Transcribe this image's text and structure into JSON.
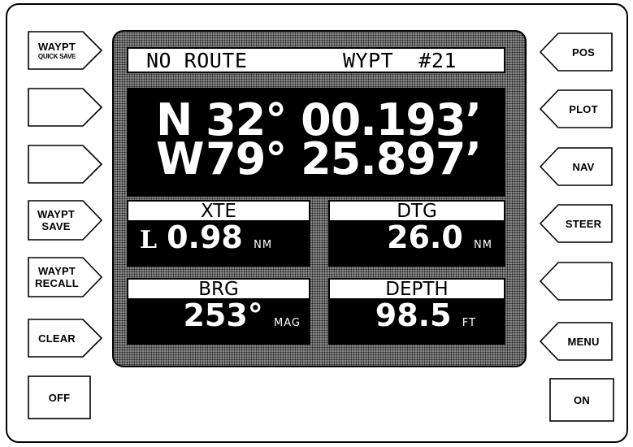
{
  "left_keys": {
    "waypt_quick_save": {
      "line1": "WAYPT",
      "line2": "QUICK SAVE"
    },
    "waypt_save": {
      "line1": "WAYPT",
      "line2": "SAVE"
    },
    "waypt_recall": {
      "line1": "WAYPT",
      "line2": "RECALL"
    },
    "clear": "CLEAR",
    "off": "OFF"
  },
  "right_keys": {
    "pos": "POS",
    "plot": "PLOT",
    "nav": "NAV",
    "steer": "STEER",
    "menu": "MENU",
    "on": "ON"
  },
  "screen": {
    "route": "NO ROUTE",
    "waypoint": "WYPT  #21",
    "latitude": {
      "hemisphere": "N",
      "value": "32° 00.193’"
    },
    "longitude": {
      "hemisphere": "W",
      "value": "79° 25.897’"
    },
    "xte": {
      "label": "XTE",
      "direction": "L",
      "value": "0.98",
      "unit": "NM"
    },
    "dtg": {
      "label": "DTG",
      "value": "26.0",
      "unit": "NM"
    },
    "brg": {
      "label": "BRG",
      "value": "253°",
      "unit": "MAG"
    },
    "depth": {
      "label": "DEPTH",
      "value": "98.5",
      "unit": "FT"
    }
  }
}
